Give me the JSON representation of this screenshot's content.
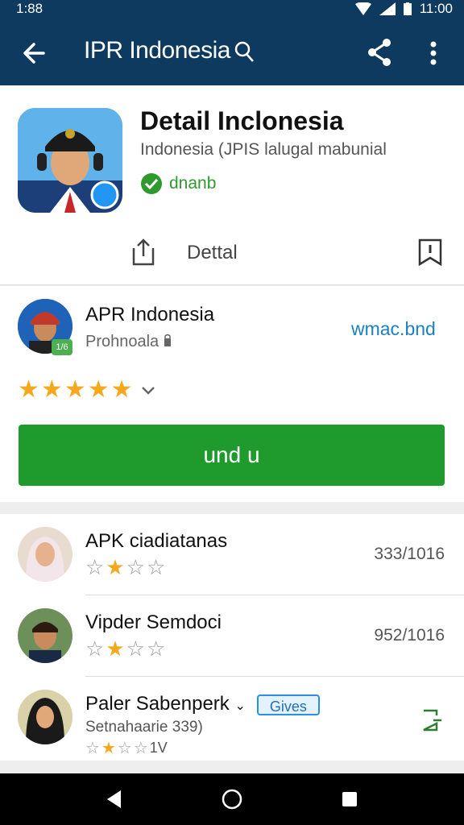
{
  "status_bar": {
    "time": "1:88",
    "clock_right": "11:00"
  },
  "app_bar": {
    "title": "IPR Indonesia",
    "title_icon": "search-person-icon"
  },
  "hero": {
    "title": "Detail Inclonesia",
    "subtitle": "Indonesia  (JPIS lalugal mabunial",
    "verified_label": "dnanb",
    "action_label": "Dettal"
  },
  "developer": {
    "name": "APR Indonesia",
    "subtitle": "Prohnoala",
    "badge": "1/6",
    "link": "wmac.bnd",
    "rating": 5
  },
  "install_button": {
    "label": "und u"
  },
  "reviews": [
    {
      "name": "APK ciadiatanas",
      "date": "333/1016",
      "rating": 2,
      "max": 4
    },
    {
      "name": "Vipder Semdoci",
      "date": "952/1016",
      "rating": 2,
      "max": 4
    },
    {
      "name": "Paler Sabenperk",
      "badge": "Gives",
      "subtitle": "Setnahaarie 339)",
      "rating_text": "1V",
      "rating": 2,
      "max": 4
    }
  ],
  "colors": {
    "app_bar": "#0d3a5e",
    "install_green": "#1f9a2c",
    "star": "#f4a81d",
    "link": "#1a7fc4"
  }
}
